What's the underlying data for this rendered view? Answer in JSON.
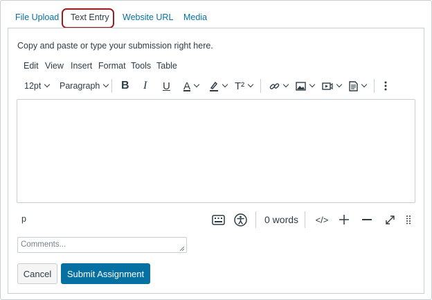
{
  "tabs": [
    {
      "label": "File Upload"
    },
    {
      "label": "Text Entry"
    },
    {
      "label": "Website URL"
    },
    {
      "label": "Media"
    }
  ],
  "active_tab": "Text Entry",
  "instructions": "Copy and paste or type your submission right here.",
  "menubar": [
    "Edit",
    "View",
    "Insert",
    "Format",
    "Tools",
    "Table"
  ],
  "toolbar": {
    "font_size": "12pt",
    "block_format": "Paragraph",
    "bold": "B",
    "italic": "I",
    "underline": "U",
    "text_color": "A",
    "superscript": "T²"
  },
  "statusbar": {
    "path": "p",
    "word_count": "0 words",
    "html_toggle": "</>"
  },
  "comments": {
    "placeholder": "Comments..."
  },
  "buttons": {
    "cancel": "Cancel",
    "submit": "Submit Assignment"
  },
  "colors": {
    "link": "#0770a3",
    "primary": "#0770a3",
    "highlight": "#9b1b1f",
    "border": "#c7cdd1",
    "text": "#2d3b45"
  }
}
